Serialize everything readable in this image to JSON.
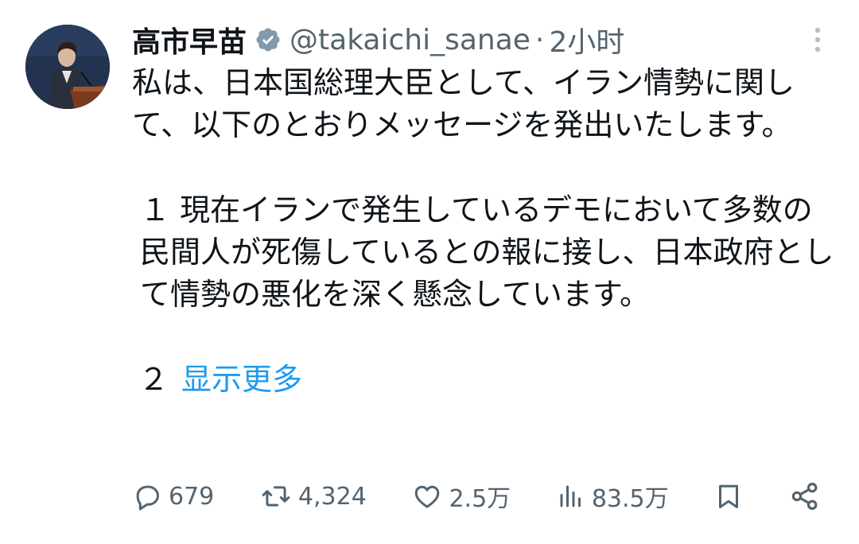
{
  "author": {
    "display_name": "高市早苗",
    "handle": "@takaichi_sanae",
    "separator": "·",
    "time": "2小时",
    "verified_icon": "verified-badge-icon"
  },
  "tweet": {
    "para1": "私は、日本国総理大臣として、イラン情勢に関して、以下のとおりメッセージを発出いたします。",
    "para2": "１ 現在イランで発生しているデモにおいて多数の民間人が死傷しているとの報に接し、日本政府として情勢の悪化を深く懸念しています。",
    "para3_prefix": "２",
    "show_more": "显示更多"
  },
  "actions": {
    "reply_count": "679",
    "retweet_count": "4,324",
    "like_count": "2.5万",
    "view_count": "83.5万"
  },
  "colors": {
    "text": "#0f1419",
    "secondary": "#536471",
    "link": "#1d9bf0",
    "badge": "#829aab"
  }
}
